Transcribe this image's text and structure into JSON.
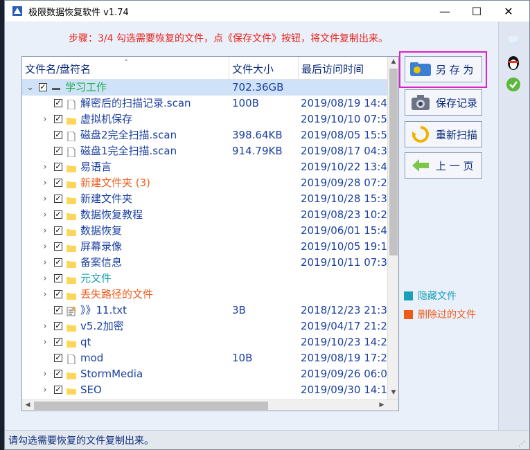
{
  "window": {
    "title": "极限数据恢复软件 v1.74",
    "minimize": "—",
    "maximize": "☐",
    "close": "✕"
  },
  "step_text": "步骤：3/4 勾选需要恢复的文件，点《保存文件》按钮，将文件复制出来。",
  "columns": {
    "name": "文件名/盘符名",
    "size": "文件大小",
    "date": "最后访问时间"
  },
  "rows": [
    {
      "expander": "⌄",
      "check": "✓",
      "icon": "folder-minus",
      "name": "学习工作",
      "size": "702.36GB",
      "date": "",
      "color": "green",
      "level": 0,
      "selected": true
    },
    {
      "expander": "",
      "check": "✓",
      "icon": "file",
      "name": "解密后的扫描记录.scan",
      "size": "100B",
      "date": "2019/08/19 14:4",
      "color": "blue",
      "level": 1
    },
    {
      "expander": "›",
      "check": "✓",
      "icon": "folder",
      "name": "虚拟机保存",
      "size": "",
      "date": "2019/10/10 07:5",
      "color": "blue",
      "level": 1
    },
    {
      "expander": "",
      "check": "✓",
      "icon": "file",
      "name": "磁盘2完全扫描.scan",
      "size": "398.64KB",
      "date": "2019/08/05 15:5",
      "color": "blue",
      "level": 1
    },
    {
      "expander": "",
      "check": "✓",
      "icon": "file",
      "name": "磁盘1完全扫描.scan",
      "size": "914.79KB",
      "date": "2019/08/17 04:3",
      "color": "blue",
      "level": 1
    },
    {
      "expander": "›",
      "check": "✓",
      "icon": "folder",
      "name": "易语言",
      "size": "",
      "date": "2019/10/22 13:4",
      "color": "blue",
      "level": 1
    },
    {
      "expander": "›",
      "check": "✓",
      "icon": "folder",
      "name": "新建文件夹 (3)",
      "size": "",
      "date": "2019/09/28 07:2",
      "color": "orange",
      "level": 1
    },
    {
      "expander": "›",
      "check": "✓",
      "icon": "folder",
      "name": "新建文件夹",
      "size": "",
      "date": "2019/10/28 15:3",
      "color": "blue",
      "level": 1
    },
    {
      "expander": "›",
      "check": "✓",
      "icon": "folder",
      "name": "数据恢复教程",
      "size": "",
      "date": "2019/08/23 10:2",
      "color": "blue",
      "level": 1
    },
    {
      "expander": "›",
      "check": "✓",
      "icon": "folder",
      "name": "数据恢复",
      "size": "",
      "date": "2019/06/01 15:4",
      "color": "blue",
      "level": 1
    },
    {
      "expander": "›",
      "check": "✓",
      "icon": "folder",
      "name": "屏幕录像",
      "size": "",
      "date": "2019/10/05 19:1",
      "color": "blue",
      "level": 1
    },
    {
      "expander": "›",
      "check": "✓",
      "icon": "folder",
      "name": "备案信息",
      "size": "",
      "date": "2019/10/11 07:3",
      "color": "blue",
      "level": 1
    },
    {
      "expander": "›",
      "check": "✓",
      "icon": "folder",
      "name": "元文件",
      "size": "",
      "date": "",
      "color": "teal",
      "level": 1
    },
    {
      "expander": "›",
      "check": "✓",
      "icon": "folder",
      "name": "丢失路径的文件",
      "size": "",
      "date": "",
      "color": "orange",
      "level": 1
    },
    {
      "expander": "",
      "check": "✓",
      "icon": "file-text",
      "name": "》》11.txt",
      "size": "3B",
      "date": "2018/12/23 21:3",
      "color": "blue",
      "level": 1
    },
    {
      "expander": "›",
      "check": "✓",
      "icon": "folder",
      "name": "v5.2加密",
      "size": "",
      "date": "2019/04/17 21:2",
      "color": "blue",
      "level": 1
    },
    {
      "expander": "›",
      "check": "✓",
      "icon": "folder",
      "name": "qt",
      "size": "",
      "date": "2019/10/23 14:2",
      "color": "blue",
      "level": 1
    },
    {
      "expander": "",
      "check": "✓",
      "icon": "file",
      "name": "mod",
      "size": "10B",
      "date": "2019/08/19 17:2",
      "color": "blue",
      "level": 1
    },
    {
      "expander": "›",
      "check": "✓",
      "icon": "folder",
      "name": "StormMedia",
      "size": "",
      "date": "2019/09/26 06:0",
      "color": "blue",
      "level": 1
    },
    {
      "expander": "›",
      "check": "✓",
      "icon": "folder",
      "name": "SEO",
      "size": "",
      "date": "2019/09/30 14:1",
      "color": "blue",
      "level": 1
    },
    {
      "expander": "›",
      "check": "✓",
      "icon": "folder",
      "name": "",
      "size": "",
      "date": "",
      "color": "blue",
      "level": 1
    }
  ],
  "buttons": {
    "save_as": "另 存 为",
    "save_record": "保存记录",
    "rescan": "重新扫描",
    "prev_page": "上 一 页"
  },
  "legend": [
    {
      "label": "隐藏文件",
      "color": "#17a0b8"
    },
    {
      "label": "删除过的文件",
      "color": "#f05a18"
    }
  ],
  "status": "请勾选需要恢复的文件复制出来。",
  "colors": {
    "blue": "#1a3fa0",
    "orange": "#f05a18",
    "teal": "#17a0b8",
    "green": "#17b04a",
    "highlight": "#e020c8"
  }
}
